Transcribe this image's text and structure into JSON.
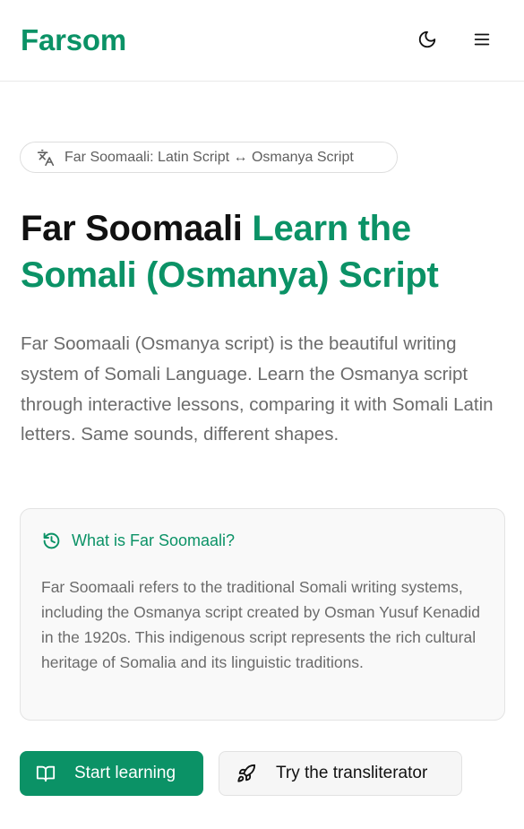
{
  "header": {
    "logo": "Farsom",
    "icons": {
      "theme": "moon-icon",
      "menu": "hamburger-menu-icon"
    }
  },
  "badge": {
    "icon": "translate-icon",
    "text": "Far Soomaali: Latin Script ↔ Osmanya Script"
  },
  "hero": {
    "title_dark": "Far Soomaali",
    "title_green": "Learn the Somali (Osmanya) Script",
    "intro": "Far Soomaali (Osmanya script) is the beautiful writing system of Somali Language. Learn the Osmanya script through interactive lessons, comparing it with Somali Latin letters. Same sounds, different shapes."
  },
  "info_card": {
    "icon": "history-icon",
    "title": "What is Far Soomaali?",
    "body": "Far Soomaali refers to the traditional Somali writing systems, including the Osmanya script created by Osman Yusuf Kenadid in the 1920s. This indigenous script represents the rich cultural heritage of Somalia and its linguistic traditions."
  },
  "actions": {
    "primary": {
      "label": "Start learning",
      "icon": "book-open-icon"
    },
    "secondary": {
      "label": "Try the transliterator",
      "icon": "rocket-icon"
    }
  },
  "colors": {
    "brand_green": "#0b9266",
    "text_dark": "#111111",
    "text_muted": "#6b6b6b"
  }
}
